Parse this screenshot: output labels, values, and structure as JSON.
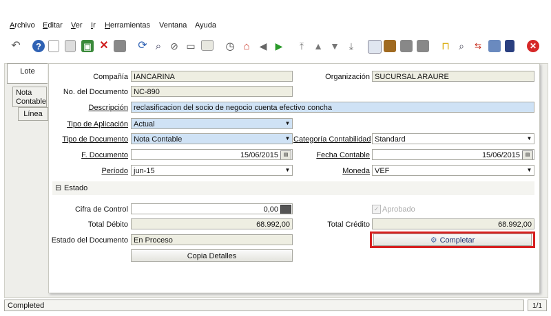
{
  "menu": [
    {
      "first": "A",
      "rest": "rchivo"
    },
    {
      "first": "E",
      "rest": "ditar"
    },
    {
      "first": "V",
      "rest": "er"
    },
    {
      "first": "I",
      "rest": "r"
    },
    {
      "first": "H",
      "rest": "erramientas"
    },
    {
      "first": "",
      "rest": "Ventana"
    },
    {
      "first": "",
      "rest": "Ayuda"
    }
  ],
  "tabs": {
    "lote": "Lote",
    "nota_line1": "Nota",
    "nota_line2": "Contable",
    "linea": "Línea"
  },
  "form": {
    "compania_label": "Compañía",
    "compania": "IANCARINA",
    "organizacion_label": "Organización",
    "organizacion": "SUCURSAL ARAURE",
    "no_doc_label": "No. del Documento",
    "no_doc": "NC-890",
    "descripcion_label": "Descripción",
    "descripcion": "reclasificacion del socio de negocio cuenta efectivo concha",
    "tipo_aplicacion_label": "Tipo de Aplicación",
    "tipo_aplicacion": "Actual",
    "tipo_documento_label": "Tipo de Documento",
    "tipo_documento": "Nota Contable",
    "categoria_label": "Categoría Contabilidad",
    "categoria": "Standard",
    "f_documento_label": "F. Documento",
    "f_documento": "15/06/2015",
    "fecha_contable_label": "Fecha Contable",
    "fecha_contable": "15/06/2015",
    "periodo_label": "Período",
    "periodo": "jun-15",
    "moneda_label": "Moneda",
    "moneda": "VEF"
  },
  "estado_section": {
    "toggle": "⊟",
    "label": "Estado"
  },
  "estado": {
    "cifra_label": "Cifra de Control",
    "cifra": "0,00",
    "aprobado_label": "Aprobado",
    "total_debito_label": "Total Débito",
    "total_debito": "68.992,00",
    "total_credito_label": "Total Crédito",
    "total_credito": "68.992,00",
    "estado_doc_label": "Estado del Documento",
    "estado_doc": "En Proceso",
    "completar_label": "Completar",
    "copia_label": "Copia Detalles"
  },
  "status": {
    "message": "Completed",
    "record": "1/1"
  },
  "colors": {
    "highlight": "#d62020",
    "accent_blue": "#cfe2f5",
    "readonly": "#eeeee2"
  }
}
